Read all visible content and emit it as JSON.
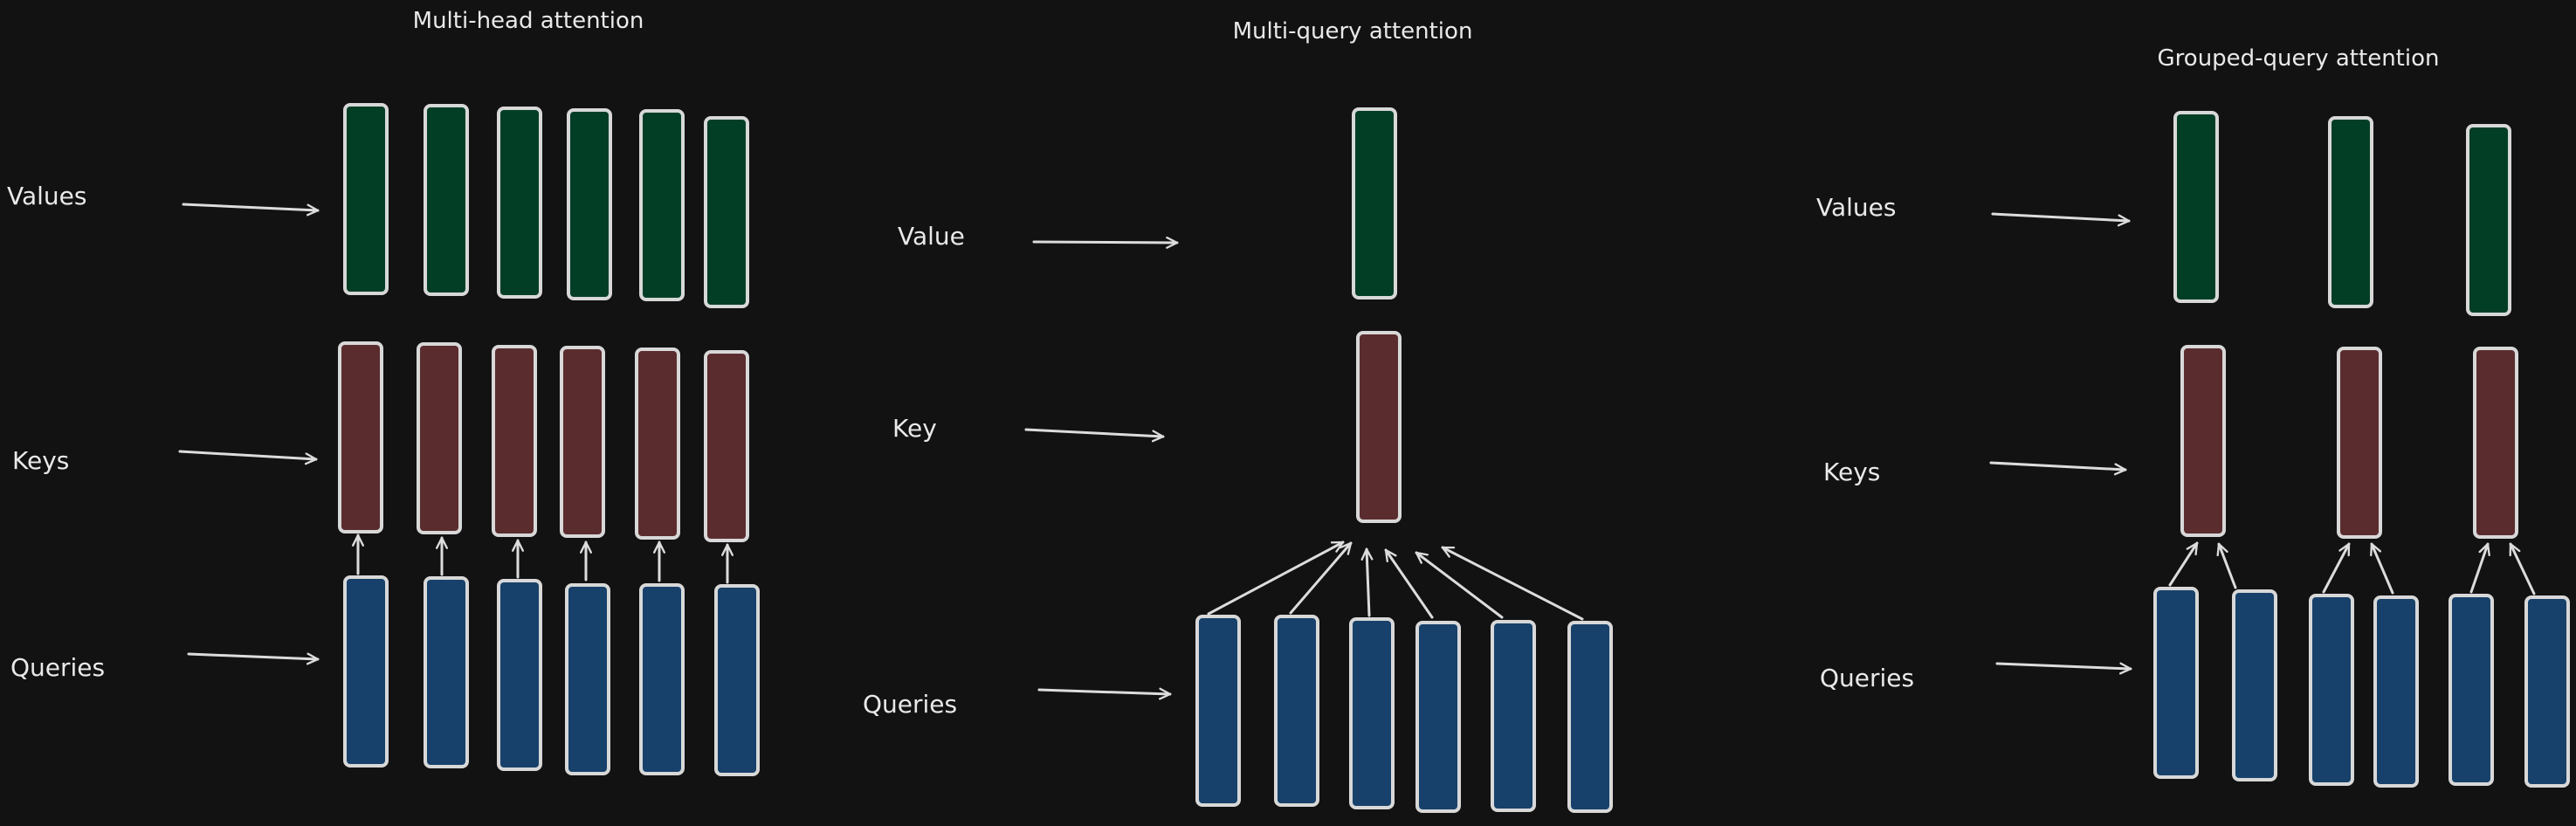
{
  "colors": {
    "background": "#121212",
    "values": "#023e26",
    "keys": "#5b2c2e",
    "queries": "#17416a",
    "stroke": "#d8d8d8",
    "text": "#e9e9e9"
  },
  "panels": [
    {
      "id": "mha",
      "title": "Multi-head attention",
      "row_labels": [
        "Values",
        "Keys",
        "Queries"
      ],
      "counts": {
        "values": 6,
        "keys": 6,
        "queries": 6
      }
    },
    {
      "id": "mqa",
      "title": "Multi-query attention",
      "row_labels": [
        "Value",
        "Key",
        "Queries"
      ],
      "counts": {
        "values": 1,
        "keys": 1,
        "queries": 6
      }
    },
    {
      "id": "gqa",
      "title": "Grouped-query attention",
      "row_labels": [
        "Values",
        "Keys",
        "Queries"
      ],
      "counts": {
        "values": 3,
        "keys": 3,
        "queries": 6
      }
    }
  ]
}
